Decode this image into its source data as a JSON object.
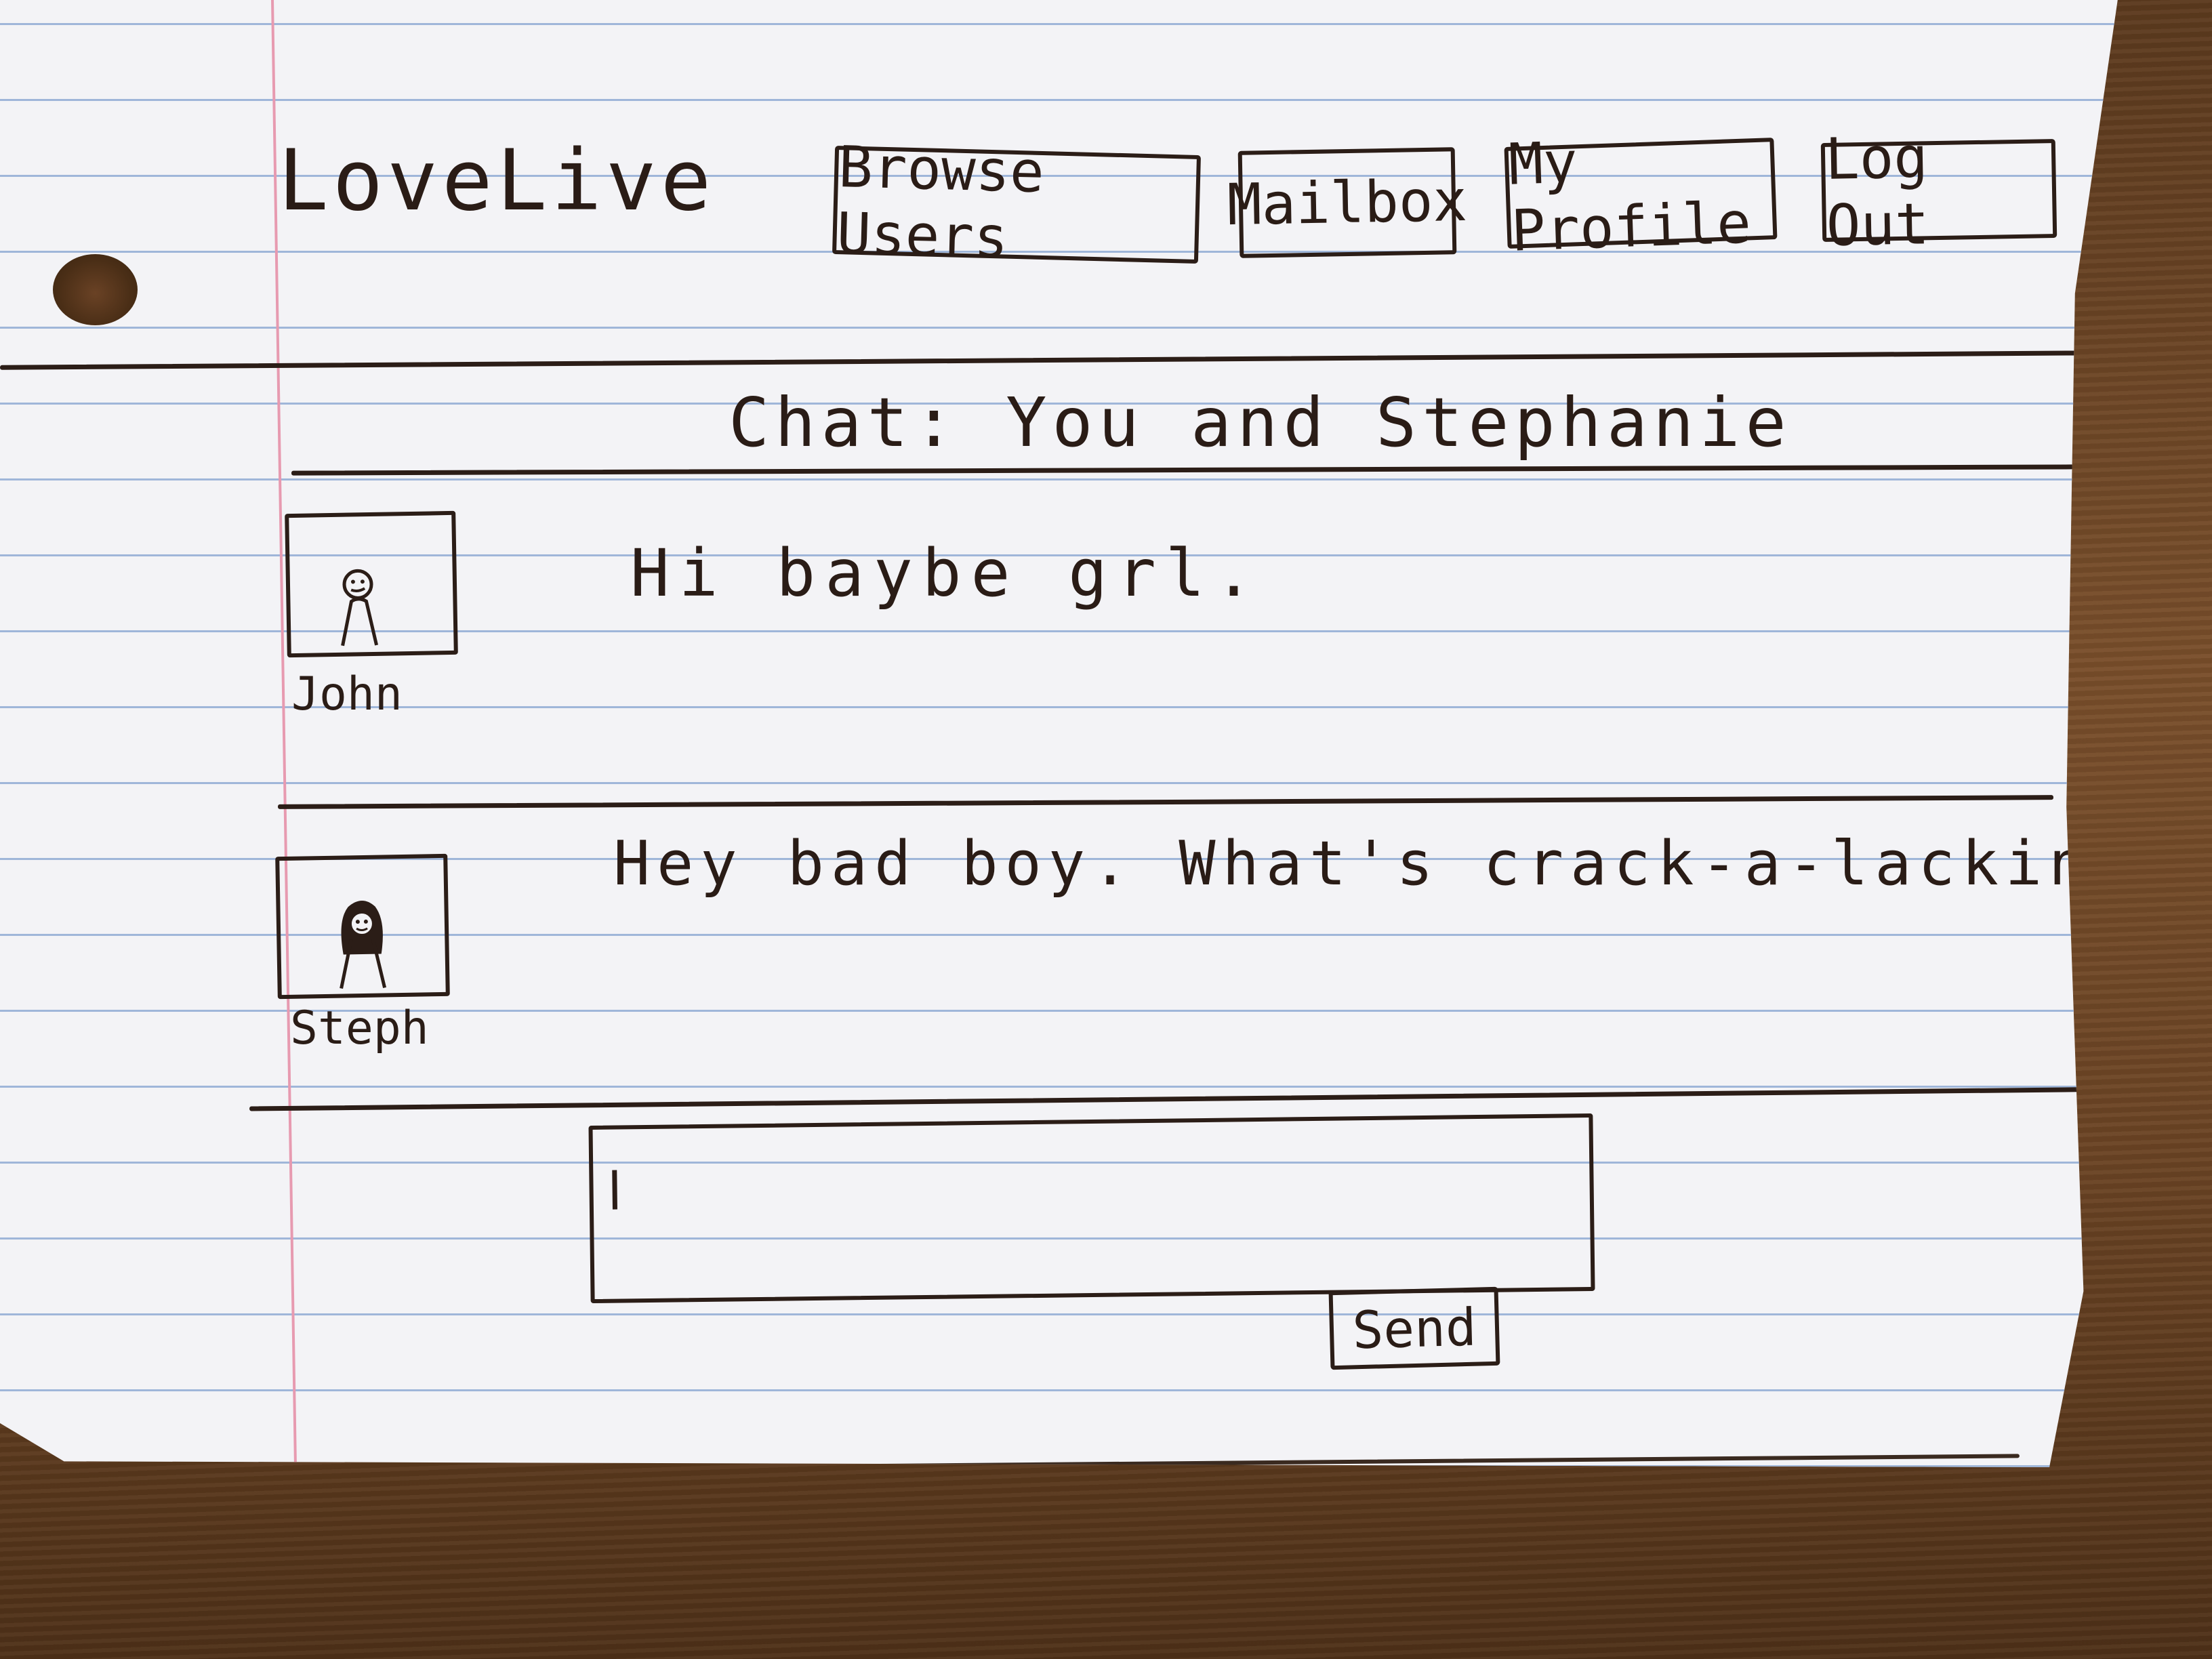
{
  "app": {
    "logo": "LoveLive"
  },
  "nav": {
    "items": [
      {
        "label": "Browse Users"
      },
      {
        "label": "Mailbox"
      },
      {
        "label": "My Profile"
      },
      {
        "label": "Log Out"
      }
    ]
  },
  "chat": {
    "title": "Chat: You and Stephanie",
    "messages": [
      {
        "sender": "John",
        "text": "Hi baybe grl.",
        "avatar_icon": "person-avatar-icon"
      },
      {
        "sender": "Steph",
        "text": "Hey bad boy. What's crack-a-lackin'.",
        "avatar_icon": "person-long-hair-avatar-icon"
      }
    ]
  },
  "composer": {
    "value": "",
    "send_label": "Send"
  },
  "colors": {
    "ink": "#2b1d17",
    "paper": "#f3f3f6",
    "ruled_line": "#9fb6d9",
    "margin_line": "#e79ab0"
  }
}
